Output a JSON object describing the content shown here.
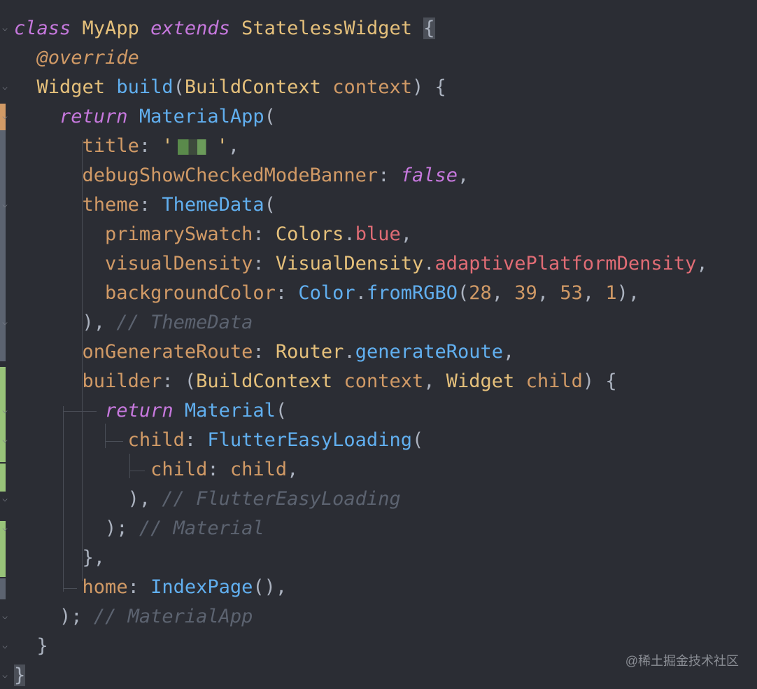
{
  "code": {
    "lines": [
      {
        "tokens": [
          {
            "t": "class",
            "c": "kw"
          },
          {
            "t": " ",
            "c": "punc"
          },
          {
            "t": "MyApp",
            "c": "cls"
          },
          {
            "t": " ",
            "c": "punc"
          },
          {
            "t": "extends",
            "c": "kw"
          },
          {
            "t": " ",
            "c": "punc"
          },
          {
            "t": "StatelessWidget",
            "c": "cls"
          },
          {
            "t": " ",
            "c": "punc"
          },
          {
            "t": "{",
            "c": "brace-hl"
          }
        ]
      },
      {
        "tokens": [
          {
            "t": "  ",
            "c": "punc"
          },
          {
            "t": "@override",
            "c": "ann"
          }
        ]
      },
      {
        "tokens": [
          {
            "t": "  ",
            "c": "punc"
          },
          {
            "t": "Widget",
            "c": "cls"
          },
          {
            "t": " ",
            "c": "punc"
          },
          {
            "t": "build",
            "c": "fn"
          },
          {
            "t": "(",
            "c": "punc"
          },
          {
            "t": "BuildContext",
            "c": "cls"
          },
          {
            "t": " ",
            "c": "punc"
          },
          {
            "t": "context",
            "c": "param"
          },
          {
            "t": ") {",
            "c": "punc"
          }
        ]
      },
      {
        "tokens": [
          {
            "t": "    ",
            "c": "punc"
          },
          {
            "t": "return",
            "c": "kw"
          },
          {
            "t": " ",
            "c": "punc"
          },
          {
            "t": "MaterialApp",
            "c": "fn"
          },
          {
            "t": "(",
            "c": "punc"
          }
        ]
      },
      {
        "tokens": [
          {
            "t": "      ",
            "c": "punc"
          },
          {
            "t": "title",
            "c": "param"
          },
          {
            "t": ": ",
            "c": "punc"
          },
          {
            "t": "'",
            "c": "cls"
          },
          {
            "t": "",
            "c": "blur"
          },
          {
            "t": "'",
            "c": "cls"
          },
          {
            "t": ",",
            "c": "punc"
          }
        ]
      },
      {
        "tokens": [
          {
            "t": "      ",
            "c": "punc"
          },
          {
            "t": "debugShowCheckedModeBanner",
            "c": "param"
          },
          {
            "t": ": ",
            "c": "punc"
          },
          {
            "t": "false",
            "c": "kwv"
          },
          {
            "t": ",",
            "c": "punc"
          }
        ]
      },
      {
        "tokens": [
          {
            "t": "      ",
            "c": "punc"
          },
          {
            "t": "theme",
            "c": "param"
          },
          {
            "t": ": ",
            "c": "punc"
          },
          {
            "t": "ThemeData",
            "c": "fn"
          },
          {
            "t": "(",
            "c": "punc"
          }
        ]
      },
      {
        "tokens": [
          {
            "t": "        ",
            "c": "punc"
          },
          {
            "t": "primarySwatch",
            "c": "param"
          },
          {
            "t": ": ",
            "c": "punc"
          },
          {
            "t": "Colors",
            "c": "cls"
          },
          {
            "t": ".",
            "c": "punc"
          },
          {
            "t": "blue",
            "c": "prop"
          },
          {
            "t": ",",
            "c": "punc"
          }
        ]
      },
      {
        "tokens": [
          {
            "t": "        ",
            "c": "punc"
          },
          {
            "t": "visualDensity",
            "c": "param"
          },
          {
            "t": ": ",
            "c": "punc"
          },
          {
            "t": "VisualDensity",
            "c": "cls"
          },
          {
            "t": ".",
            "c": "punc"
          },
          {
            "t": "adaptivePlatformDensity",
            "c": "prop"
          },
          {
            "t": ",",
            "c": "punc"
          }
        ]
      },
      {
        "tokens": [
          {
            "t": "        ",
            "c": "punc"
          },
          {
            "t": "backgroundColor",
            "c": "param"
          },
          {
            "t": ": ",
            "c": "punc"
          },
          {
            "t": "Color",
            "c": "fn"
          },
          {
            "t": ".",
            "c": "punc"
          },
          {
            "t": "fromRGBO",
            "c": "fn"
          },
          {
            "t": "(",
            "c": "punc"
          },
          {
            "t": "28",
            "c": "num"
          },
          {
            "t": ", ",
            "c": "punc"
          },
          {
            "t": "39",
            "c": "num"
          },
          {
            "t": ", ",
            "c": "punc"
          },
          {
            "t": "53",
            "c": "num"
          },
          {
            "t": ", ",
            "c": "punc"
          },
          {
            "t": "1",
            "c": "num"
          },
          {
            "t": "),",
            "c": "punc"
          }
        ]
      },
      {
        "tokens": [
          {
            "t": "      ",
            "c": "punc"
          },
          {
            "t": "), ",
            "c": "punc"
          },
          {
            "t": "// ThemeData",
            "c": "cmt"
          }
        ]
      },
      {
        "tokens": [
          {
            "t": "      ",
            "c": "punc"
          },
          {
            "t": "onGenerateRoute",
            "c": "param"
          },
          {
            "t": ": ",
            "c": "punc"
          },
          {
            "t": "Router",
            "c": "cls"
          },
          {
            "t": ".",
            "c": "punc"
          },
          {
            "t": "generateRoute",
            "c": "fn"
          },
          {
            "t": ",",
            "c": "punc"
          }
        ]
      },
      {
        "tokens": [
          {
            "t": "      ",
            "c": "punc"
          },
          {
            "t": "builder",
            "c": "param"
          },
          {
            "t": ": (",
            "c": "punc"
          },
          {
            "t": "BuildContext",
            "c": "cls"
          },
          {
            "t": " ",
            "c": "punc"
          },
          {
            "t": "context",
            "c": "param"
          },
          {
            "t": ", ",
            "c": "punc"
          },
          {
            "t": "Widget",
            "c": "cls"
          },
          {
            "t": " ",
            "c": "punc"
          },
          {
            "t": "child",
            "c": "param"
          },
          {
            "t": ") {",
            "c": "punc"
          }
        ]
      },
      {
        "tokens": [
          {
            "t": "        ",
            "c": "punc"
          },
          {
            "t": "return",
            "c": "kw"
          },
          {
            "t": " ",
            "c": "punc"
          },
          {
            "t": "Material",
            "c": "fn"
          },
          {
            "t": "(",
            "c": "punc"
          }
        ]
      },
      {
        "tokens": [
          {
            "t": "          ",
            "c": "punc"
          },
          {
            "t": "child",
            "c": "param"
          },
          {
            "t": ": ",
            "c": "punc"
          },
          {
            "t": "FlutterEasyLoading",
            "c": "fn"
          },
          {
            "t": "(",
            "c": "punc"
          }
        ]
      },
      {
        "tokens": [
          {
            "t": "            ",
            "c": "punc"
          },
          {
            "t": "child",
            "c": "param"
          },
          {
            "t": ": ",
            "c": "punc"
          },
          {
            "t": "child",
            "c": "param"
          },
          {
            "t": ",",
            "c": "punc"
          }
        ]
      },
      {
        "tokens": [
          {
            "t": "          ",
            "c": "punc"
          },
          {
            "t": "), ",
            "c": "punc"
          },
          {
            "t": "// FlutterEasyLoading",
            "c": "cmt"
          }
        ]
      },
      {
        "tokens": [
          {
            "t": "        ",
            "c": "punc"
          },
          {
            "t": "); ",
            "c": "punc"
          },
          {
            "t": "// Material",
            "c": "cmt"
          }
        ]
      },
      {
        "tokens": [
          {
            "t": "      ",
            "c": "punc"
          },
          {
            "t": "},",
            "c": "punc"
          }
        ]
      },
      {
        "tokens": [
          {
            "t": "      ",
            "c": "punc"
          },
          {
            "t": "home",
            "c": "param"
          },
          {
            "t": ": ",
            "c": "punc"
          },
          {
            "t": "IndexPage",
            "c": "fn"
          },
          {
            "t": "(),",
            "c": "punc"
          }
        ]
      },
      {
        "tokens": [
          {
            "t": "    ",
            "c": "punc"
          },
          {
            "t": "); ",
            "c": "punc"
          },
          {
            "t": "// MaterialApp",
            "c": "cmt"
          }
        ]
      },
      {
        "tokens": [
          {
            "t": "  ",
            "c": "punc"
          },
          {
            "t": "}",
            "c": "punc"
          }
        ]
      },
      {
        "tokens": [
          {
            "t": "}",
            "c": "brace-hl"
          }
        ]
      }
    ]
  },
  "gutter": {
    "change_colors": {
      "modified": "#d19a66",
      "added": "#98c379",
      "inactive": "#5c6370"
    }
  },
  "watermark": "@稀土掘金技术社区"
}
